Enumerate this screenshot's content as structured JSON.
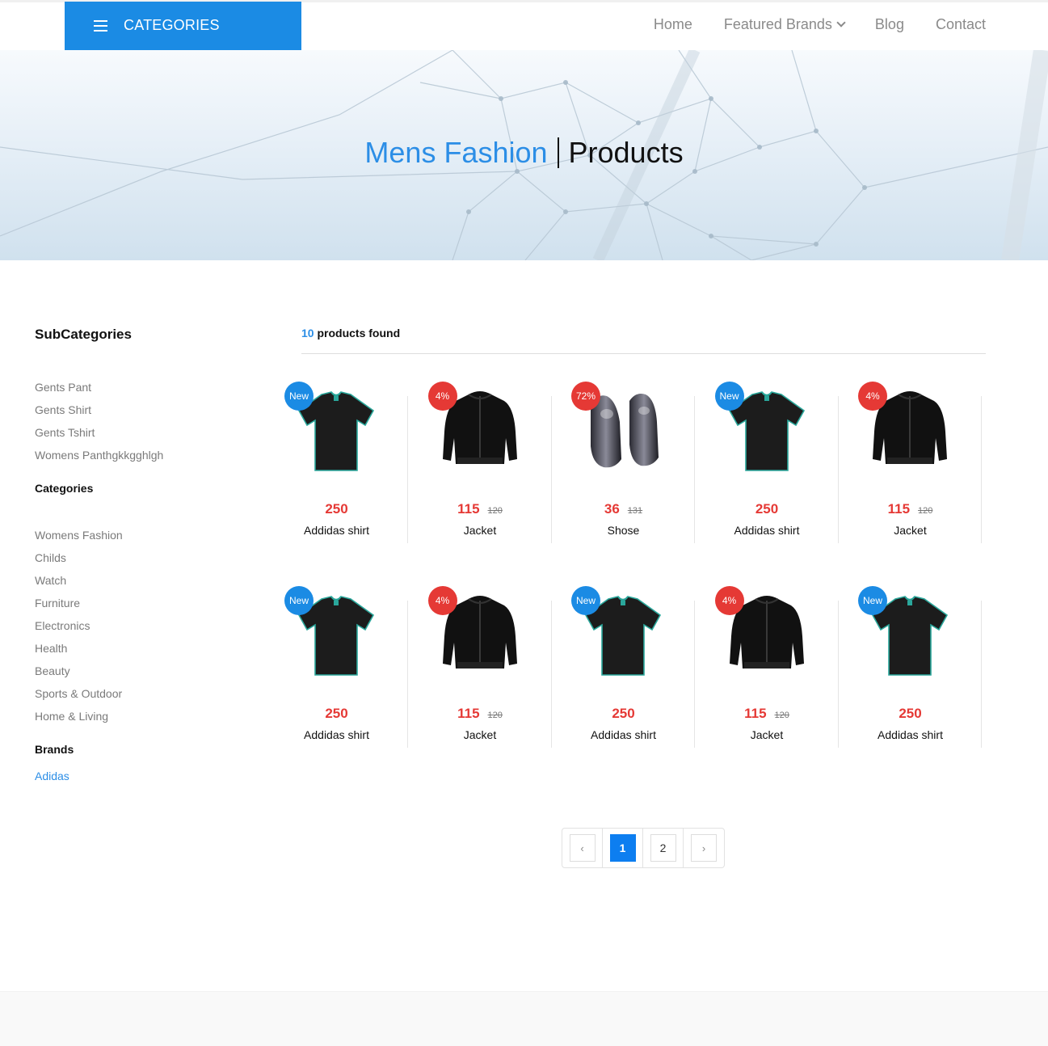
{
  "header": {
    "categories_label": "CATEGORIES",
    "nav": {
      "home": "Home",
      "featured_brands": "Featured Brands",
      "blog": "Blog",
      "contact": "Contact"
    }
  },
  "hero": {
    "title_highlight": "Mens Fashion",
    "title_rest": "Products"
  },
  "sidebar": {
    "subcategories_title": "SubCategories",
    "subcategories": [
      "Gents Pant",
      "Gents Shirt",
      "Gents Tshirt",
      "Womens Panthgkkgghlgh"
    ],
    "categories_title": "Categories",
    "categories": [
      "Womens Fashion",
      "Childs",
      "Watch",
      "Furniture",
      "Electronics",
      "Health",
      "Beauty",
      "Sports & Outdoor",
      "Home & Living"
    ],
    "brands_title": "Brands",
    "brands": [
      "Adidas"
    ]
  },
  "results": {
    "count": "10",
    "label": "products found"
  },
  "products": [
    {
      "badge": "New",
      "badge_type": "new",
      "image": "tshirt-icon",
      "price": "250",
      "old_price": "",
      "name": "Addidas shirt"
    },
    {
      "badge": "4%",
      "badge_type": "sale",
      "image": "jacket-icon",
      "price": "115",
      "old_price": "120",
      "name": "Jacket"
    },
    {
      "badge": "72%",
      "badge_type": "sale",
      "image": "shoes-icon",
      "price": "36",
      "old_price": "131",
      "name": "Shose"
    },
    {
      "badge": "New",
      "badge_type": "new",
      "image": "tshirt-icon",
      "price": "250",
      "old_price": "",
      "name": "Addidas shirt"
    },
    {
      "badge": "4%",
      "badge_type": "sale",
      "image": "jacket-icon",
      "price": "115",
      "old_price": "120",
      "name": "Jacket"
    },
    {
      "badge": "New",
      "badge_type": "new",
      "image": "tshirt-icon",
      "price": "250",
      "old_price": "",
      "name": "Addidas shirt"
    },
    {
      "badge": "4%",
      "badge_type": "sale",
      "image": "jacket-icon",
      "price": "115",
      "old_price": "120",
      "name": "Jacket"
    },
    {
      "badge": "New",
      "badge_type": "new",
      "image": "tshirt-icon",
      "price": "250",
      "old_price": "",
      "name": "Addidas shirt"
    },
    {
      "badge": "4%",
      "badge_type": "sale",
      "image": "jacket-icon",
      "price": "115",
      "old_price": "120",
      "name": "Jacket"
    },
    {
      "badge": "New",
      "badge_type": "new",
      "image": "tshirt-icon",
      "price": "250",
      "old_price": "",
      "name": "Addidas shirt"
    }
  ],
  "pagination": {
    "prev": "‹",
    "pages": [
      "1",
      "2"
    ],
    "current": "1",
    "next": "›"
  },
  "colors": {
    "accent": "#1b8be4",
    "sale": "#e53935",
    "active_page": "#0d7ef0"
  }
}
